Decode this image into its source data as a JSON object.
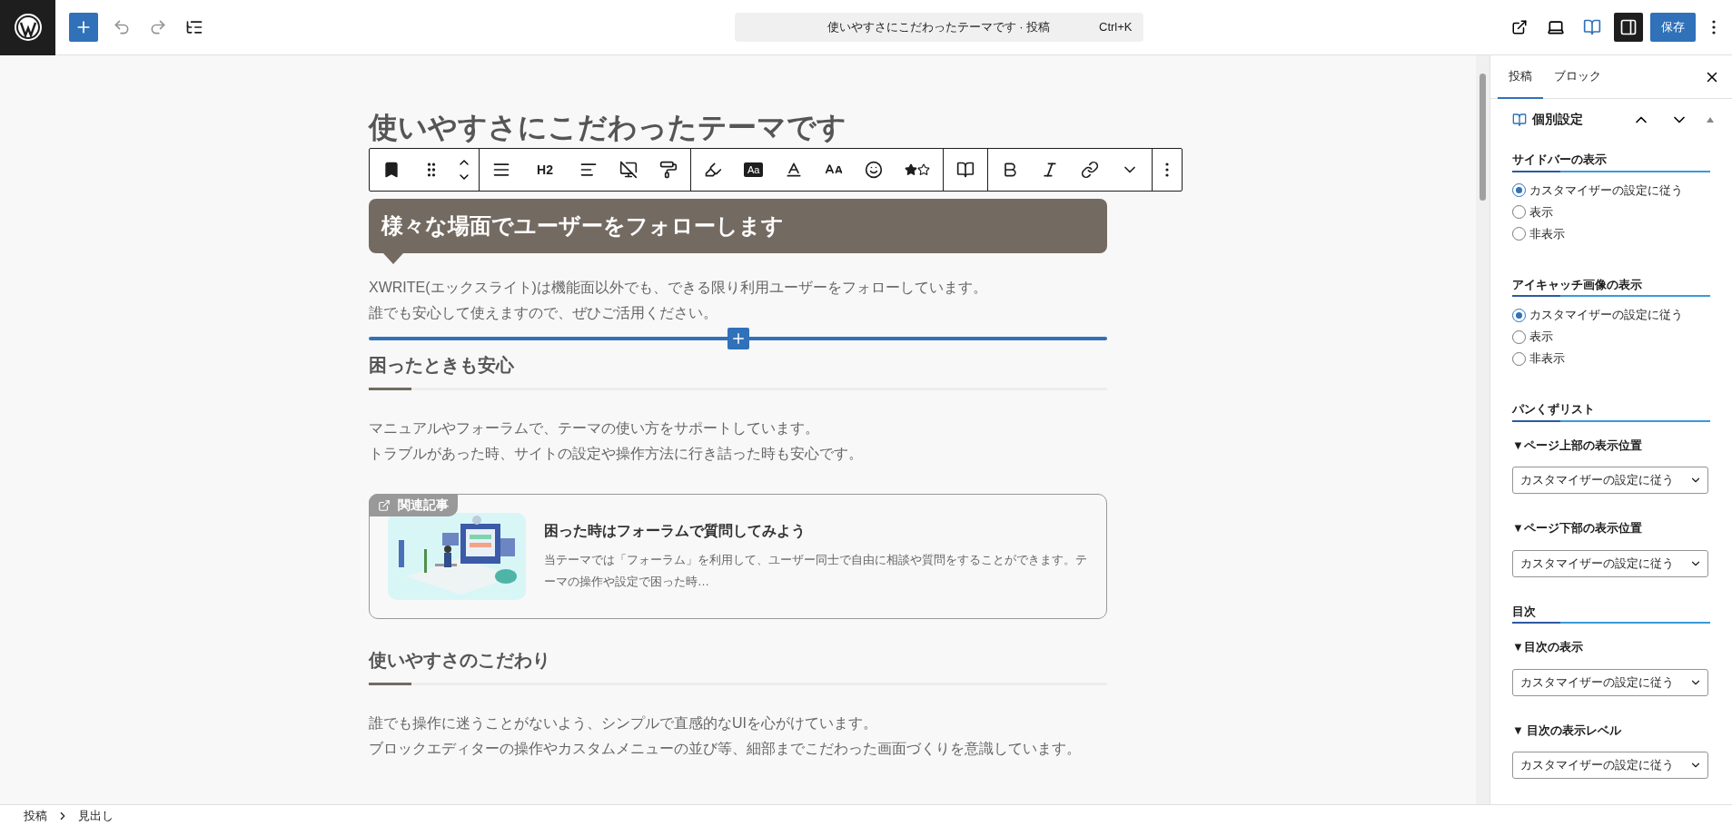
{
  "topbar": {
    "command": "使いやすさにこだわったテーマです · 投稿",
    "shortcut": "Ctrl+K",
    "save": "保存",
    "sidebar_toggle_pressed": true
  },
  "toolbar": {
    "groups": [
      [
        {
          "kind": "bookmark"
        },
        {
          "kind": "drag"
        },
        {
          "kind": "movers"
        }
      ],
      [
        {
          "kind": "align-wide"
        },
        {
          "kind": "heading",
          "label": "H2"
        },
        {
          "kind": "align-left"
        },
        {
          "kind": "device"
        },
        {
          "kind": "roller"
        }
      ],
      [
        {
          "kind": "highlighter"
        },
        {
          "kind": "boxed",
          "label": "Aa"
        },
        {
          "kind": "text-color"
        },
        {
          "kind": "font-size"
        },
        {
          "kind": "emoji"
        },
        {
          "kind": "stars"
        }
      ],
      [
        {
          "kind": "book"
        }
      ],
      [
        {
          "kind": "bold"
        },
        {
          "kind": "italic"
        },
        {
          "kind": "link"
        },
        {
          "kind": "chevron"
        }
      ],
      [
        {
          "kind": "more"
        }
      ]
    ]
  },
  "post": {
    "title": "使いやすさにこだわったテーマです",
    "blocks": [
      {
        "kind": "balloon-heading",
        "text": "様々な場面でユーザーをフォローします"
      },
      {
        "kind": "paragraph",
        "lines": [
          "XWRITE(エックスライト)は機能面以外でも、できる限り利用ユーザーをフォローしています。",
          "誰でも安心して使えますので、ぜひご活用ください。"
        ]
      },
      {
        "kind": "inserter"
      },
      {
        "kind": "heading",
        "text": "困ったときも安心"
      },
      {
        "kind": "paragraph",
        "lines": [
          "マニュアルやフォーラムで、テーマの使い方をサポートしています。",
          "トラブルがあった時、サイトの設定や操作方法に行き詰った時も安心です。"
        ]
      },
      {
        "kind": "related",
        "badge": "関連記事",
        "title": "困った時はフォーラムで質問してみよう",
        "excerpt": "当テーマでは「フォーラム」を利用して、ユーザー同士で自由に相談や質問をすることができます。テーマの操作や設定で困った時…"
      },
      {
        "kind": "heading",
        "text": "使いやすさのこだわり"
      },
      {
        "kind": "paragraph",
        "lines": [
          "誰でも操作に迷うことがないよう、シンプルで直感的なUIを心がけています。",
          "ブロックエディターの操作やカスタムメニューの並び等、細部までこだわった画面づくりを意識しています。"
        ]
      }
    ]
  },
  "breadcrumb": [
    "投稿",
    "見出し"
  ],
  "sidebar": {
    "tabs": [
      {
        "label": "投稿",
        "selected": true
      },
      {
        "label": "ブロック",
        "selected": false
      }
    ],
    "panel_title": "個別設定",
    "expanded": true,
    "sections": [
      {
        "title": "サイドバーの表示",
        "fields": [
          {
            "kind": "radio",
            "options": [
              {
                "label": "カスタマイザーの設定に従う",
                "selected": true
              },
              {
                "label": "表示",
                "selected": false
              },
              {
                "label": "非表示",
                "selected": false
              }
            ]
          }
        ]
      },
      {
        "title": "アイキャッチ画像の表示",
        "fields": [
          {
            "kind": "radio",
            "options": [
              {
                "label": "カスタマイザーの設定に従う",
                "selected": true
              },
              {
                "label": "表示",
                "selected": false
              },
              {
                "label": "非表示",
                "selected": false
              }
            ]
          }
        ]
      },
      {
        "title": "パンくずリスト",
        "fields": [
          {
            "kind": "select",
            "label": "▼ページ上部の表示位置",
            "value": "カスタマイザーの設定に従う"
          },
          {
            "kind": "select",
            "label": "▼ページ下部の表示位置",
            "value": "カスタマイザーの設定に従う"
          }
        ]
      },
      {
        "title": "目次",
        "fields": [
          {
            "kind": "select",
            "label": "▼目次の表示",
            "value": "カスタマイザーの設定に従う"
          },
          {
            "kind": "select",
            "label": "▼ 目次の表示レベル",
            "value": "カスタマイザーの設定に従う"
          }
        ]
      }
    ]
  }
}
